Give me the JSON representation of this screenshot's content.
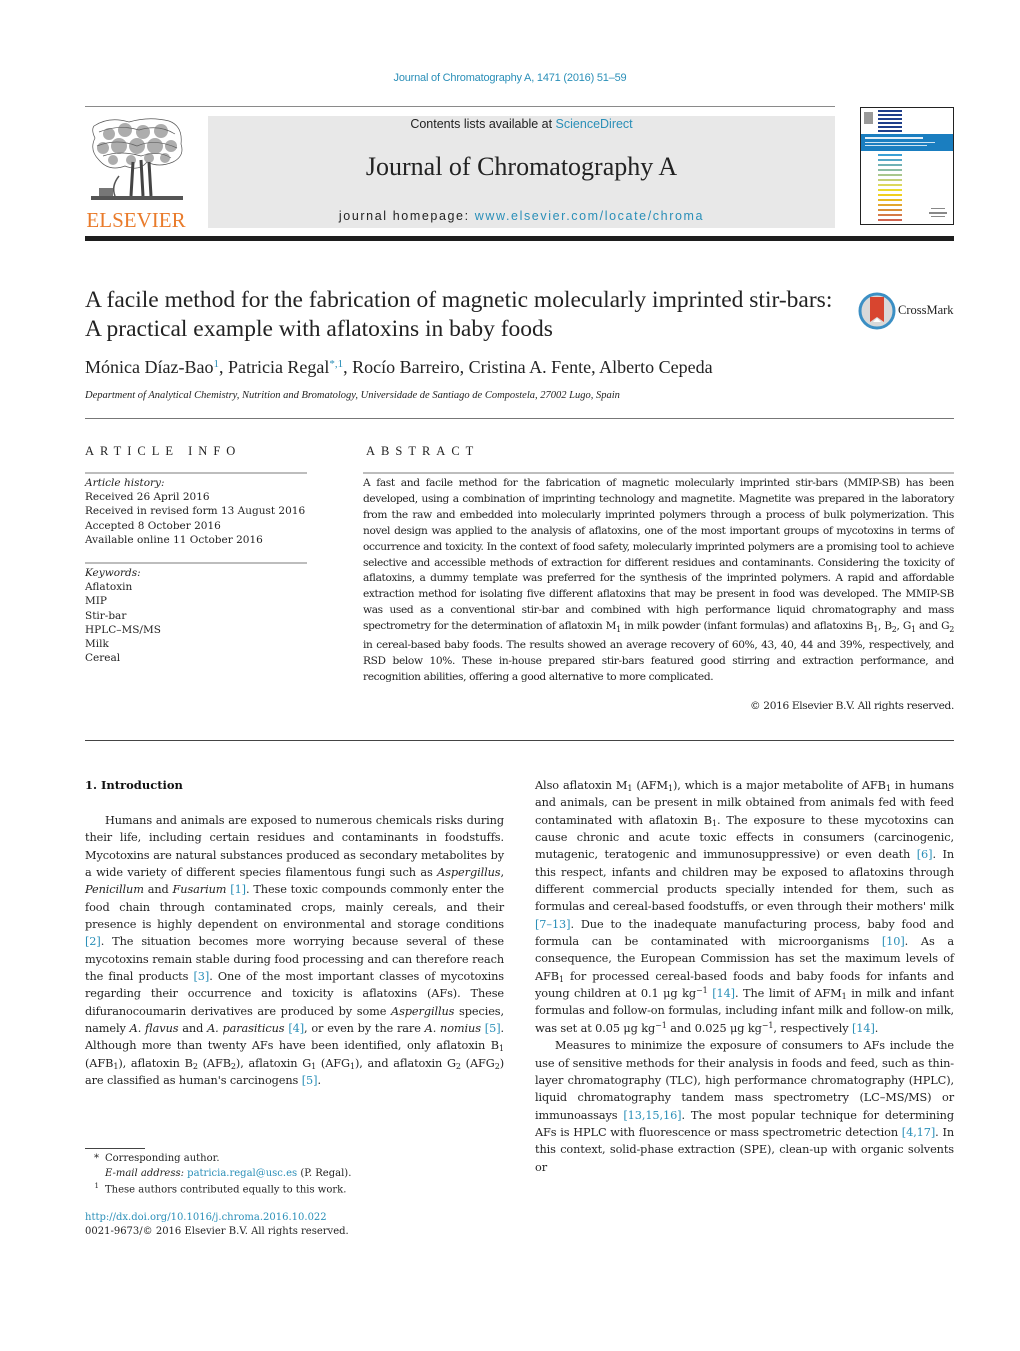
{
  "header": {
    "citation": "Journal of Chromatography A, 1471 (2016) 51–59",
    "publisher_logo_text": "ELSEVIER",
    "contents_prefix": "Contents lists available at ",
    "contents_link": "ScienceDirect",
    "journal_name": "Journal of Chromatography A",
    "homepage_prefix": "journal homepage: ",
    "homepage_link": "www.elsevier.com/locate/chroma",
    "cover_alt": "Journal cover thumbnail",
    "colors": {
      "link": "#2a8fb8",
      "publisher_orange": "#e97b2b",
      "masthead_bg": "#e8e8e8"
    }
  },
  "article": {
    "title": "A facile method for the fabrication of magnetic molecularly imprinted stir-bars: A practical example with aflatoxins in baby foods",
    "crossmark_label": "CrossMark",
    "authors": [
      {
        "name": "Mónica Díaz-Bao",
        "marks": "1"
      },
      {
        "name": "Patricia Regal",
        "marks": "*,1"
      },
      {
        "name": "Rocío Barreiro",
        "marks": ""
      },
      {
        "name": "Cristina A. Fente",
        "marks": ""
      },
      {
        "name": "Alberto Cepeda",
        "marks": ""
      }
    ],
    "affiliation": "Department of Analytical Chemistry, Nutrition and Bromatology, Universidade de Santiago de Compostela, 27002 Lugo, Spain"
  },
  "article_info": {
    "heading": "ARTICLE INFO",
    "history_label": "Article history:",
    "history": [
      "Received 26 April 2016",
      "Received in revised form 13 August 2016",
      "Accepted 8 October 2016",
      "Available online 11 October 2016"
    ],
    "keywords_label": "Keywords:",
    "keywords": [
      "Aflatoxin",
      "MIP",
      "Stir-bar",
      "HPLC–MS/MS",
      "Milk",
      "Cereal"
    ]
  },
  "abstract": {
    "heading": "ABSTRACT",
    "text_a": "A fast and facile method for the fabrication of magnetic molecularly imprinted stir-bars (MMIP-SB) has been developed, using a combination of imprinting technology and magnetite. Magnetite was prepared in the laboratory from the raw and embedded into molecularly imprinted polymers through a process of bulk polymerization. This novel design was applied to the analysis of aflatoxins, one of the most important groups of mycotoxins in terms of occurrence and toxicity. In the context of food safety, molecularly imprinted polymers are a promising tool to achieve selective and accessible methods of extraction for different residues and contaminants. Considering the toxicity of aflatoxins, a dummy template was preferred for the synthesis of the imprinted polymers. A rapid and affordable extraction method for isolating five different aflatoxins that may be present in food was developed. The MMIP-SB was used as a conventional stir-bar and combined with high performance liquid chromatography and mass spectrometry for the determination of aflatoxin M",
    "text_b": " in milk powder (infant formulas) and aflatoxins B",
    "text_c": ", B",
    "text_d": ", G",
    "text_e": " and G",
    "text_f": " in cereal-based baby foods. The results showed an average recovery of 60%, 43, 40, 44 and 39%, respectively, and RSD below 10%. These in-house prepared stir-bars featured good stirring and extraction performance, and recognition abilities, offering a good alternative to more complicated.",
    "sub1": "1",
    "sub2": "2",
    "copyright": "© 2016 Elsevier B.V. All rights reserved."
  },
  "body": {
    "section_heading": "1.  Introduction",
    "refs": [
      "[1]",
      "[2]",
      "[3]",
      "[4]",
      "[5]",
      "[6]",
      "[7–13]",
      "[10]",
      "[14]",
      "[13,15,16]",
      "[4,17]"
    ],
    "left": {
      "p1_a": "Humans and animals are exposed to numerous chemicals risks during their life, including certain residues and contaminants in foodstuffs. Mycotoxins are natural substances produced as secondary metabolites by a wide variety of different species filamentous fungi such as ",
      "aspergillus": "Aspergillus",
      "comma": ", ",
      "penicillum": "Penicillum",
      "and": " and ",
      "fusarium": "Fusarium",
      "p1_b": ". These toxic compounds commonly enter the food chain through contaminated crops, mainly cereals, and their presence is highly dependent on environmental and storage conditions ",
      "p1_c": ". The situation becomes more worrying because several of these mycotoxins remain stable during food processing and can therefore reach the final products ",
      "p1_d": ". One of the most important classes of mycotoxins regarding their occurrence and toxicity is aflatoxins (AFs). These difuranocoumarin derivatives are produced by some ",
      "p1_e": " species, namely ",
      "a_flavus": "A. flavus",
      "a_parasiticus": "A. parasiticus",
      "p1_f": ", or even by the rare ",
      "a_nomius": "A. nomius",
      "p1_g": ". Although more than twenty AFs have been identified, only aflatoxin B",
      "p1_h": " (AFB",
      "p1_i": "), aflatoxin B",
      "p1_j": " (AFB",
      "p1_k": "), aflatoxin G",
      "p1_l": " (AFG",
      "p1_m": "), and aflatoxin G",
      "p1_n": " (AFG",
      "p1_o": ") are classified as human's carcinogens "
    },
    "right": {
      "p1_a": "Also aflatoxin M",
      "p1_b": " (AFM",
      "p1_c": "), which is a major metabolite of AFB",
      "p1_d": " in humans and animals, can be present in milk obtained from animals fed with feed contaminated with aflatoxin B",
      "p1_e": ". The exposure to these mycotoxins can cause chronic and acute toxic effects in consumers (carcinogenic, mutagenic, teratogenic and immunosuppressive) or even death ",
      "p1_f": ". In this respect, infants and children may be exposed to aflatoxins through different commercial products specially intended for them, such as formulas and cereal-based foodstuffs, or even through their mothers' milk ",
      "p1_g": ". Due to the inadequate manufacturing process, baby food and formula can be contaminated with microorganisms ",
      "p1_h": ". As a consequence, the European Commission has set the maximum levels of AFB",
      "p1_i": " for processed cereal-based foods and baby foods for infants and young children at 0.1 μg kg",
      "p1_j": ". The limit of AFM",
      "p1_k": " in milk and infant formulas and follow-on formulas, including infant milk and follow-on milk, was set at 0.05 μg kg",
      "p1_l": " and 0.025 μg kg",
      "p1_m": ", respectively ",
      "p2_a": "Measures to minimize the exposure of consumers to AFs include the use of sensitive methods for their analysis in foods and feed, such as thin-layer chromatography (TLC), high performance chromatography (HPLC), liquid chromatography tandem mass spectrometry (LC–MS/MS) or immunoassays ",
      "p2_b": ". The most popular technique for determining AFs is HPLC with fluorescence or mass spectrometric detection ",
      "p2_c": ". In this context, solid-phase extraction (SPE), clean-up with organic solvents or",
      "neg1": "−1",
      "period": "."
    }
  },
  "footnotes": {
    "corr_mark": "*",
    "corr_text": "Corresponding author.",
    "email_label": "E-mail address: ",
    "email": "patricia.regal@usc.es",
    "email_suffix": " (P. Regal).",
    "equal_mark": "1",
    "equal_text": "These authors contributed equally to this work.",
    "doi": "http://dx.doi.org/10.1016/j.chroma.2016.10.022",
    "issn": "0021-9673/© 2016 Elsevier B.V. All rights reserved."
  }
}
